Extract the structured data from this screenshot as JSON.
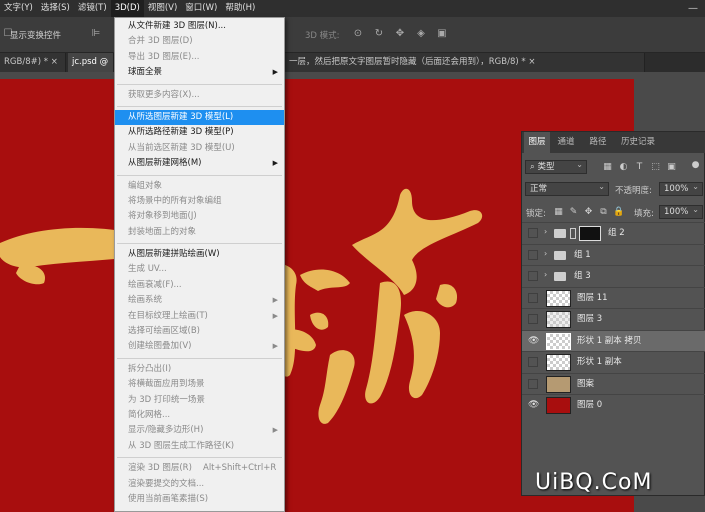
{
  "menubar": {
    "items": [
      "文字(Y)",
      "选择(S)",
      "滤镜(T)",
      "3D(D)",
      "视图(V)",
      "窗口(W)",
      "帮助(H)"
    ],
    "active_index": 3
  },
  "window_controls": {
    "minimize": "—"
  },
  "options_bar": {
    "show_transform": "显示变换控件",
    "mode_3d": "3D 模式:"
  },
  "tabs": [
    "RGB/8#) *",
    "jc.psd @",
    "一层，然后把原文字图层暂时隐藏（后面还会用到），RGB/8) *"
  ],
  "menu_3d": {
    "groups": [
      [
        {
          "label": "从文件新建 3D 图层(N)...",
          "state": "normal"
        },
        {
          "label": "合并 3D 图层(D)",
          "state": "disabled"
        },
        {
          "label": "导出 3D 图层(E)...",
          "state": "disabled"
        },
        {
          "label": "球面全景",
          "state": "normal",
          "submenu": true
        }
      ],
      [
        {
          "label": "获取更多内容(X)...",
          "state": "disabled"
        }
      ],
      [
        {
          "label": "从所选图层新建 3D 模型(L)",
          "state": "highlighted"
        },
        {
          "label": "从所选路径新建 3D 模型(P)",
          "state": "normal"
        },
        {
          "label": "从当前选区新建 3D 模型(U)",
          "state": "disabled"
        },
        {
          "label": "从图层新建网格(M)",
          "state": "normal",
          "submenu": true
        }
      ],
      [
        {
          "label": "编组对象",
          "state": "disabled"
        },
        {
          "label": "将场景中的所有对象编组",
          "state": "disabled"
        },
        {
          "label": "将对象移到地面(J)",
          "state": "disabled"
        },
        {
          "label": "封装地面上的对象",
          "state": "disabled"
        }
      ],
      [
        {
          "label": "从图层新建拼贴绘画(W)",
          "state": "normal"
        },
        {
          "label": "生成 UV...",
          "state": "disabled"
        },
        {
          "label": "绘画衰减(F)...",
          "state": "disabled"
        },
        {
          "label": "绘画系统",
          "state": "disabled",
          "submenu": true
        },
        {
          "label": "在目标纹理上绘画(T)",
          "state": "disabled",
          "submenu": true
        },
        {
          "label": "选择可绘画区域(B)",
          "state": "disabled"
        },
        {
          "label": "创建绘图叠加(V)",
          "state": "disabled",
          "submenu": true
        }
      ],
      [
        {
          "label": "拆分凸出(I)",
          "state": "disabled"
        },
        {
          "label": "将横截面应用到场景",
          "state": "disabled"
        },
        {
          "label": "为 3D 打印统一场景",
          "state": "disabled"
        },
        {
          "label": "简化网格...",
          "state": "disabled"
        },
        {
          "label": "显示/隐藏多边形(H)",
          "state": "disabled",
          "submenu": true
        },
        {
          "label": "从 3D 图层生成工作路径(K)",
          "state": "disabled"
        }
      ],
      [
        {
          "label": "渲染 3D 图层(R)",
          "state": "disabled",
          "shortcut": "Alt+Shift+Ctrl+R"
        },
        {
          "label": "渲染要提交的文档...",
          "state": "disabled"
        },
        {
          "label": "使用当前画笔素描(S)",
          "state": "disabled"
        }
      ]
    ]
  },
  "layers_panel": {
    "tabs": [
      "图层",
      "通道",
      "路径",
      "历史记录"
    ],
    "filter_kind": "类型",
    "blend_mode": "正常",
    "opacity_label": "不透明度:",
    "opacity_value": "100%",
    "lock_label": "锁定:",
    "fill_label": "填充:",
    "fill_value": "100%",
    "layers": [
      {
        "name": "组 2",
        "type": "group-masked",
        "visible": false
      },
      {
        "name": "组 1",
        "type": "group",
        "visible": false
      },
      {
        "name": "组 3",
        "type": "group",
        "visible": false
      },
      {
        "name": "图层 11",
        "type": "layer",
        "visible": false
      },
      {
        "name": "图层 3",
        "type": "layer",
        "visible": false
      },
      {
        "name": "形状 1 副本 拷贝",
        "type": "layer",
        "visible": true,
        "selected": true
      },
      {
        "name": "形状 1 副本",
        "type": "layer",
        "visible": false
      },
      {
        "name": "图案",
        "type": "layer",
        "visible": false
      },
      {
        "name": "图层 0",
        "type": "layer",
        "visible": true
      }
    ]
  },
  "colors": {
    "document_bg": "#a80e0e",
    "artwork": "#e9b85a",
    "menu_highlight": "#1e8ff0"
  },
  "watermark": "UiBQ.CoM"
}
